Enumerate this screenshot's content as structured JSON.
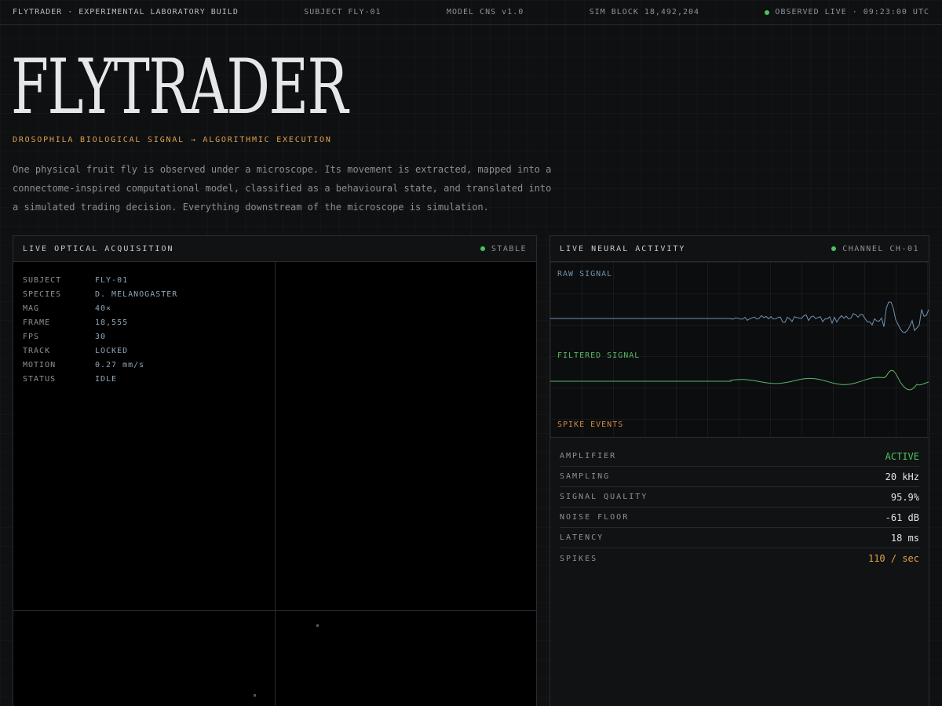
{
  "topbar": {
    "brand": "FLYTRADER · EXPERIMENTAL LABORATORY BUILD",
    "subject": "SUBJECT FLY-01",
    "model": "MODEL CNS v1.0",
    "sim_block": "SIM BLOCK 18,492,204",
    "live": "OBSERVED LIVE · 09:23:00 UTC"
  },
  "hero": {
    "title": "FLYTRADER",
    "subtitle": "DROSOPHILA BIOLOGICAL SIGNAL → ALGORITHMIC EXECUTION",
    "description": "One physical fruit fly is observed under a microscope. Its movement is extracted, mapped into a connectome-inspired computational model, classified as a behavioural state, and translated into a simulated trading decision. Everything downstream of the microscope is simulation."
  },
  "optical": {
    "title": "LIVE OPTICAL ACQUISITION",
    "status": "STABLE",
    "readout": [
      {
        "key": "SUBJECT",
        "value": "FLY-01"
      },
      {
        "key": "SPECIES",
        "value": "D. MELANOGASTER"
      },
      {
        "key": "MAG",
        "value": "40×"
      },
      {
        "key": "FRAME",
        "value": "18,555"
      },
      {
        "key": "FPS",
        "value": "30"
      },
      {
        "key": "TRACK",
        "value": "LOCKED"
      },
      {
        "key": "MOTION",
        "value": "0.27 mm/s"
      },
      {
        "key": "STATUS",
        "value": "IDLE"
      }
    ]
  },
  "neural": {
    "title": "LIVE NEURAL ACTIVITY",
    "channel": "CHANNEL CH-01",
    "labels": {
      "raw": "RAW SIGNAL",
      "filtered": "FILTERED SIGNAL",
      "spikes": "SPIKE EVENTS"
    },
    "stats": [
      {
        "key": "AMPLIFIER",
        "value": "ACTIVE"
      },
      {
        "key": "SAMPLING",
        "value": "20 kHz"
      },
      {
        "key": "SIGNAL QUALITY",
        "value": "95.9%"
      },
      {
        "key": "NOISE FLOOR",
        "value": "-61 dB"
      },
      {
        "key": "LATENCY",
        "value": "18 ms"
      },
      {
        "key": "SPIKES",
        "value": "110 / sec"
      }
    ]
  },
  "colors": {
    "accent_orange": "#e0a24a",
    "live_green": "#4cc35d",
    "raw_signal": "#6f93b3",
    "filtered_signal": "#58b866",
    "spike_label": "#d08a3c",
    "readout_value": "#8fa6b8"
  }
}
